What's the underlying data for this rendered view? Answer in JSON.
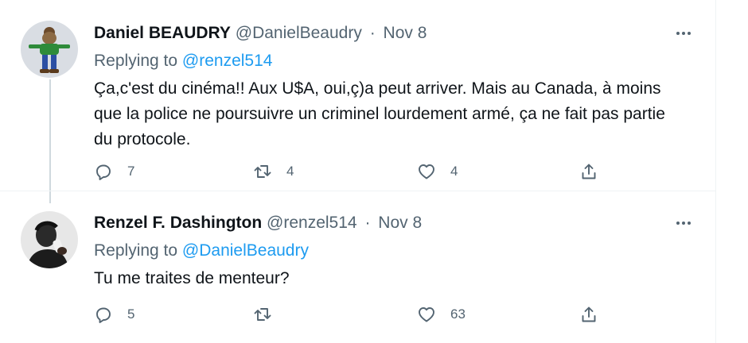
{
  "tweets": [
    {
      "author_name": "Daniel BEAUDRY",
      "handle": "@DanielBeaudry",
      "separator": "·",
      "date": "Nov 8",
      "replying_prefix": "Replying to",
      "replying_to": "@renzel514",
      "text": "Ça,c'est du cinéma!! Aux U$A, oui,ç)a peut arriver. Mais au Canada, à moins que la police ne poursuivre un criminel lourdement armé, ça ne fait pas partie du protocole.",
      "reply_count": "7",
      "retweet_count": "4",
      "like_count": "4",
      "avatar_icon": "cartoon-character-avatar"
    },
    {
      "author_name": "Renzel F. Dashington",
      "handle": "@renzel514",
      "separator": "·",
      "date": "Nov 8",
      "replying_prefix": "Replying to",
      "replying_to": "@DanielBeaudry",
      "text": "Tu me traites de menteur?",
      "reply_count": "5",
      "retweet_count": "",
      "like_count": "63",
      "avatar_icon": "person-photo-avatar"
    }
  ],
  "icons": {
    "reply": "reply-icon",
    "retweet": "retweet-icon",
    "like": "heart-icon",
    "share": "share-icon",
    "more": "more-dots-icon"
  },
  "colors": {
    "text": "#0f1419",
    "muted": "#536471",
    "link": "#1d9bf0",
    "border": "#eff3f4",
    "thread_line": "#cfd9de"
  }
}
